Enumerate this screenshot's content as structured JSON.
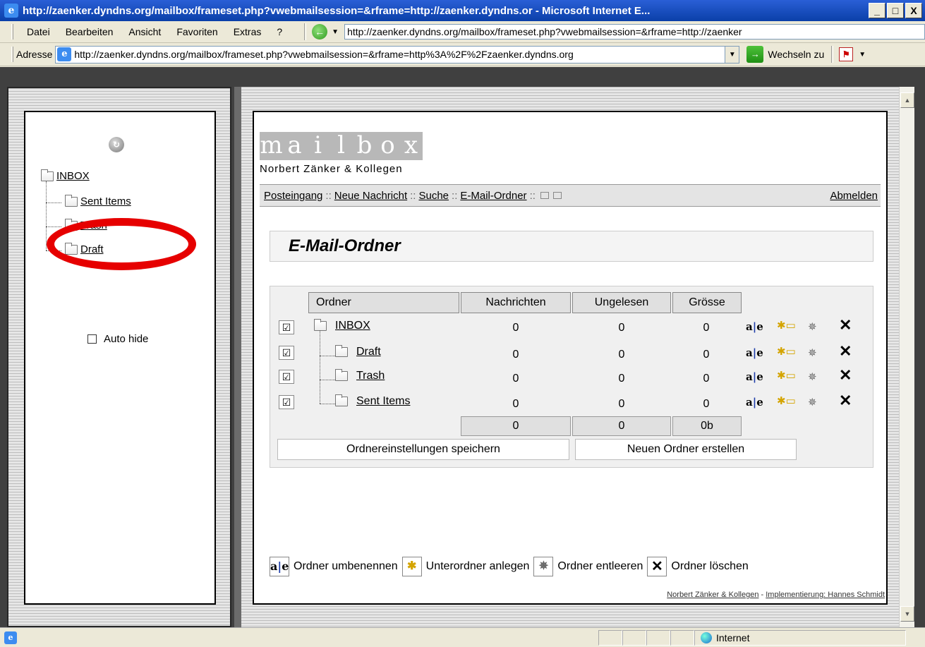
{
  "window": {
    "title": "http://zaenker.dyndns.org/mailbox/frameset.php?vwebmailsession=&rframe=http://zaenker.dyndns.or - Microsoft Internet E...",
    "controls": [
      "_",
      "□",
      "X"
    ]
  },
  "menubar": {
    "items": [
      "Datei",
      "Bearbeiten",
      "Ansicht",
      "Favoriten",
      "Extras",
      "?"
    ],
    "top_url": "http://zaenker.dyndns.org/mailbox/frameset.php?vwebmailsession=&rframe=http://zaenker"
  },
  "addressbar": {
    "label": "Adresse",
    "url": "http://zaenker.dyndns.org/mailbox/frameset.php?vwebmailsession=&rframe=http%3A%2F%2Fzaenker.dyndns.org",
    "go_label": "Wechseln zu"
  },
  "left_tree": {
    "root": "INBOX",
    "children": [
      "Sent Items",
      "Trash",
      "Draft"
    ],
    "auto_hide_label": "Auto hide",
    "highlight_color": "#e60000"
  },
  "logo": {
    "word": [
      "m",
      "a",
      "i",
      "l",
      "b",
      "o",
      "x"
    ],
    "subtitle": "Norbert Zänker & Kollegen"
  },
  "nav": {
    "inbox": "Posteingang",
    "new_message": "Neue Nachricht",
    "search": "Suche",
    "folders": "E-Mail-Ordner",
    "logout": "Abmelden",
    "separator": "::"
  },
  "section_title": "E-Mail-Ordner",
  "folder_table": {
    "headers": {
      "folder": "Ordner",
      "messages": "Nachrichten",
      "unread": "Ungelesen",
      "size": "Grösse"
    },
    "rows": [
      {
        "name": "INBOX",
        "messages": "0",
        "unread": "0",
        "size": "0",
        "checked": "☑"
      },
      {
        "name": "Draft",
        "messages": "0",
        "unread": "0",
        "size": "0",
        "checked": "☑"
      },
      {
        "name": "Trash",
        "messages": "0",
        "unread": "0",
        "size": "0",
        "checked": "☑"
      },
      {
        "name": "Sent Items",
        "messages": "0",
        "unread": "0",
        "size": "0",
        "checked": "☑"
      }
    ],
    "totals": {
      "messages": "0",
      "unread": "0",
      "size": "0b"
    },
    "save_button": "Ordnereinstellungen speichern",
    "create_button": "Neuen Ordner erstellen"
  },
  "legend": {
    "rename": "Ordner umbenennen",
    "subfolder": "Unterordner anlegen",
    "empty": "Ordner entleeren",
    "delete": "Ordner löschen"
  },
  "footer": {
    "company": "Norbert Zänker & Kollegen",
    "dash": "-",
    "implementation": "Implementierung: Hannes Schmidt"
  },
  "statusbar": {
    "zone": "Internet"
  }
}
